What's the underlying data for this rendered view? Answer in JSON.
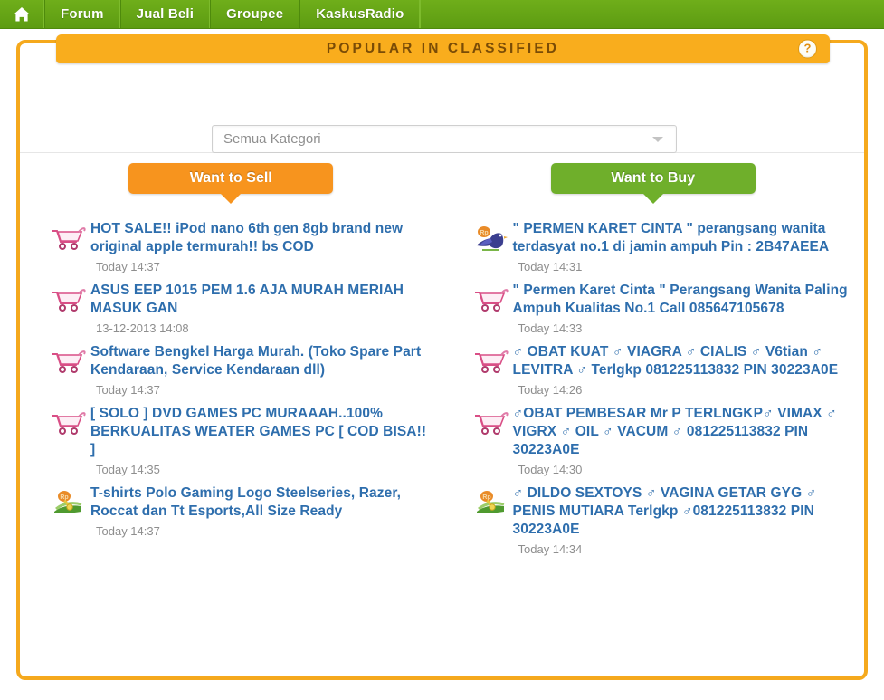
{
  "navbar": {
    "home_icon": "home-icon",
    "items": [
      {
        "label": "Forum"
      },
      {
        "label": "Jual Beli"
      },
      {
        "label": "Groupee"
      },
      {
        "label": "KaskusRadio"
      }
    ]
  },
  "banner": {
    "title": "POPULAR IN CLASSIFIED",
    "help_label": "?",
    "help_icon": "question-mark-circle-icon",
    "background_color": "#f9ad1d",
    "title_color": "#7a4c06"
  },
  "filter": {
    "category_selected": "Semua Kategori",
    "category_placeholder": "Semua Kategori",
    "caret_icon": "chevron-down-icon"
  },
  "columns": [
    {
      "tab_label": "Want to Sell",
      "tab_color": "#f7941e",
      "listings": [
        {
          "icon": "shopping-cart-icon",
          "title": "HOT SALE!! iPod nano 6th gen 8gb brand new original apple termurah!! bs COD",
          "time": "Today 14:37"
        },
        {
          "icon": "shopping-cart-icon",
          "title": "ASUS EEP 1015 PEM 1.6 AJA MURAH MERIAH MASUK GAN",
          "time": "13-12-2013 14:08"
        },
        {
          "icon": "shopping-cart-icon",
          "title": "Software Bengkel Harga Murah. (Toko Spare Part Kendaraan, Service Kendaraan dll)",
          "time": "Today 14:37"
        },
        {
          "icon": "shopping-cart-icon",
          "title": "[ SOLO ] DVD GAMES PC MURAAAH..100% BERKUALITAS WEATER GAMES PC [ COD BISA!! ]",
          "time": "Today 14:35"
        },
        {
          "icon": "money-hand-rupiah-icon",
          "title": "T-shirts Polo Gaming Logo Steelseries, Razer, Roccat dan Tt Esports,All Size Ready",
          "time": "Today 14:37"
        }
      ]
    },
    {
      "tab_label": "Want to Buy",
      "tab_color": "#6faf2b",
      "listings": [
        {
          "icon": "bird-rupiah-icon",
          "title": "\" PERMEN KARET CINTA \" perangsang wanita terdasyat no.1 di jamin ampuh Pin : 2B47AEEA",
          "time": "Today 14:31"
        },
        {
          "icon": "shopping-cart-icon",
          "title": "\" Permen Karet Cinta \" Perangsang Wanita Paling Ampuh Kualitas No.1 Call 085647105678",
          "time": "Today 14:33"
        },
        {
          "icon": "shopping-cart-icon",
          "title": "♂ OBAT KUAT ♂ VIAGRA ♂ CIALIS ♂ V6tian ♂ LEVITRA ♂ Terlgkp 081225113832 PIN 30223A0E",
          "time": "Today 14:26"
        },
        {
          "icon": "shopping-cart-icon",
          "title": "♂OBAT PEMBESAR Mr P TERLNGKP♂ VIMAX ♂ VIGRX ♂ OIL ♂ VACUM ♂ 081225113832 PIN 30223A0E",
          "time": "Today 14:30"
        },
        {
          "icon": "money-hand-rupiah-icon",
          "title": "♂ DILDO SEXTOYS ♂ VAGINA GETAR GYG ♂ PENIS MUTIARA Terlgkp ♂081225113832 PIN 30223A0E",
          "time": "Today 14:34"
        }
      ]
    }
  ],
  "theme": {
    "nav_green": "#6fae1a",
    "panel_border": "#f5a91d",
    "link_blue": "#2e6ead",
    "time_gray": "#8e8e8e"
  }
}
